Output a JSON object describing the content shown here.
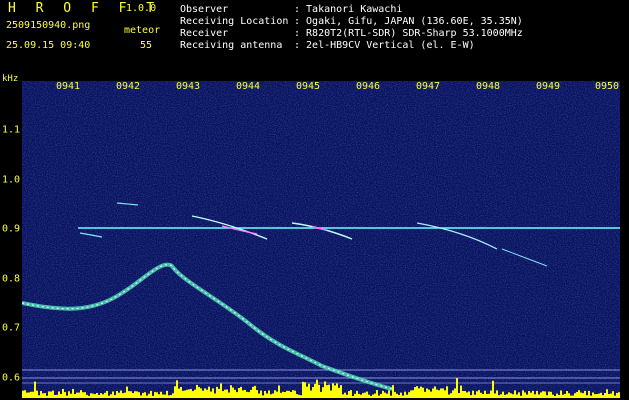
{
  "app": {
    "name": "H R O F F T",
    "version": "1.0.0",
    "file": "2509150940.png",
    "datetime": "25.09.15 09:40",
    "meteor_label": "meteor",
    "meteor_count": "55"
  },
  "info": [
    {
      "key": "Observer",
      "value": ": Takanori Kawachi"
    },
    {
      "key": "Receiving Location",
      "value": ": Ogaki, Gifu, JAPAN (136.60E, 35.35N)"
    },
    {
      "key": "Receiver",
      "value": ": R820T2(RTL-SDR) SDR-Sharp 53.1000MHz"
    },
    {
      "key": "Receiving antenna",
      "value": ": 2el-HB9CV Vertical (el. E-W)"
    }
  ],
  "axis": {
    "unit": "kHz",
    "x_labels": [
      "0941",
      "0942",
      "0943",
      "0944",
      "0945",
      "0946",
      "0947",
      "0948",
      "0949",
      "0950"
    ],
    "y_labels": [
      "1.1",
      "1.0",
      "0.9",
      "0.8",
      "0.7",
      "0.6"
    ]
  },
  "colors": {
    "background": "#000000",
    "label": "#ffff33",
    "text": "#ffffff",
    "plot_bg": "#08105a",
    "carrier": "#66ffff",
    "bottom_bars": "#ffff00"
  }
}
